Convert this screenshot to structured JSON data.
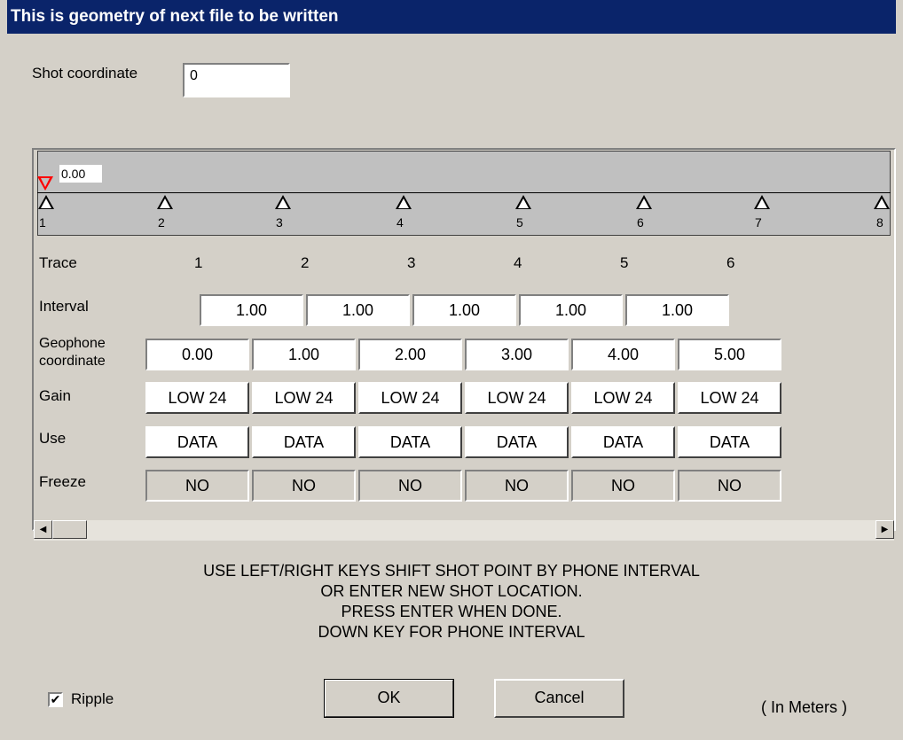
{
  "title": "This is geometry of next file to be written",
  "shot": {
    "label": "Shot coordinate",
    "value": "0",
    "marker_value": "0.00"
  },
  "geophone_markers": [
    "1",
    "2",
    "3",
    "4",
    "5",
    "6",
    "7",
    "8"
  ],
  "table": {
    "trace_label": "Trace",
    "traces": [
      "1",
      "2",
      "3",
      "4",
      "5",
      "6"
    ],
    "interval_label": "Interval",
    "intervals": [
      "1.00",
      "1.00",
      "1.00",
      "1.00",
      "1.00"
    ],
    "geophone_label_1": "Geophone",
    "geophone_label_2": "coordinate",
    "geophone_coords": [
      "0.00",
      "1.00",
      "2.00",
      "3.00",
      "4.00",
      "5.00"
    ],
    "gain_label": "Gain",
    "gains": [
      "LOW 24",
      "LOW 24",
      "LOW 24",
      "LOW 24",
      "LOW 24",
      "LOW 24"
    ],
    "use_label": "Use",
    "uses": [
      "DATA",
      "DATA",
      "DATA",
      "DATA",
      "DATA",
      "DATA"
    ],
    "freeze_label": "Freeze",
    "freezes": [
      "NO",
      "NO",
      "NO",
      "NO",
      "NO",
      "NO"
    ]
  },
  "scroll": {
    "left_icon": "scroll-left-arrow-icon",
    "right_icon": "scroll-right-arrow-icon"
  },
  "instructions": [
    "USE LEFT/RIGHT KEYS SHIFT SHOT POINT BY PHONE INTERVAL",
    "OR ENTER NEW SHOT LOCATION.",
    "PRESS ENTER WHEN DONE.",
    "DOWN KEY FOR PHONE INTERVAL"
  ],
  "ripple": {
    "label": "Ripple",
    "checked": true
  },
  "ok_label": "OK",
  "cancel_label": "Cancel",
  "units": "( In Meters )",
  "colors": {
    "titlebar": "#0a246a",
    "shot_marker": "#ff0000",
    "dialog_bg": "#d4d0c8"
  }
}
